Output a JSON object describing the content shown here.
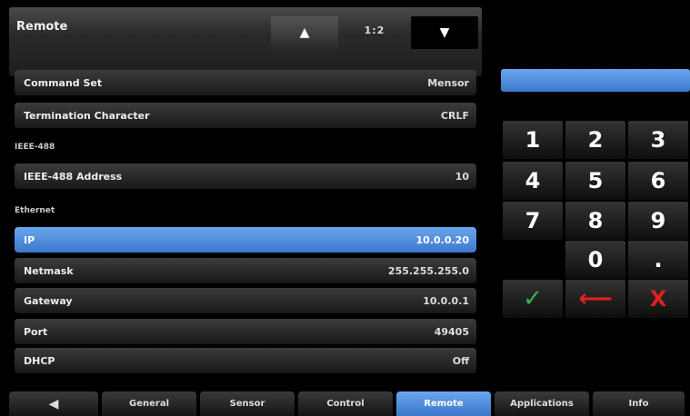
{
  "header": {
    "title": "Remote",
    "page_indicator": "1:2",
    "up_glyph": "▲",
    "down_glyph": "▼"
  },
  "rows": [
    {
      "label": "Command Set",
      "value": "Mensor"
    },
    {
      "label": "Termination Character",
      "value": "CRLF"
    }
  ],
  "sections": {
    "ieee": {
      "heading": "IEEE-488",
      "rows": [
        {
          "label": "IEEE-488 Address",
          "value": "10"
        }
      ]
    },
    "ethernet": {
      "heading": "Ethernet",
      "rows": [
        {
          "label": "IP",
          "value": "10.0.0.20"
        },
        {
          "label": "Netmask",
          "value": "255.255.255.0"
        },
        {
          "label": "Gateway",
          "value": "10.0.0.1"
        },
        {
          "label": "Port",
          "value": "49405"
        },
        {
          "label": "DHCP",
          "value": "Off"
        }
      ]
    }
  },
  "keypad": {
    "keys": [
      "1",
      "2",
      "3",
      "4",
      "5",
      "6",
      "7",
      "8",
      "9",
      "0",
      "."
    ],
    "confirm_glyph": "✓",
    "backspace_glyph": "⟵",
    "cancel_glyph": "X"
  },
  "colors": {
    "accent": "#3b78cc",
    "confirm": "#3bb54a",
    "danger": "#e02020"
  },
  "tabs": [
    {
      "label": "◀"
    },
    {
      "label": "General"
    },
    {
      "label": "Sensor"
    },
    {
      "label": "Control"
    },
    {
      "label": "Remote"
    },
    {
      "label": "Applications"
    },
    {
      "label": "Info"
    }
  ]
}
